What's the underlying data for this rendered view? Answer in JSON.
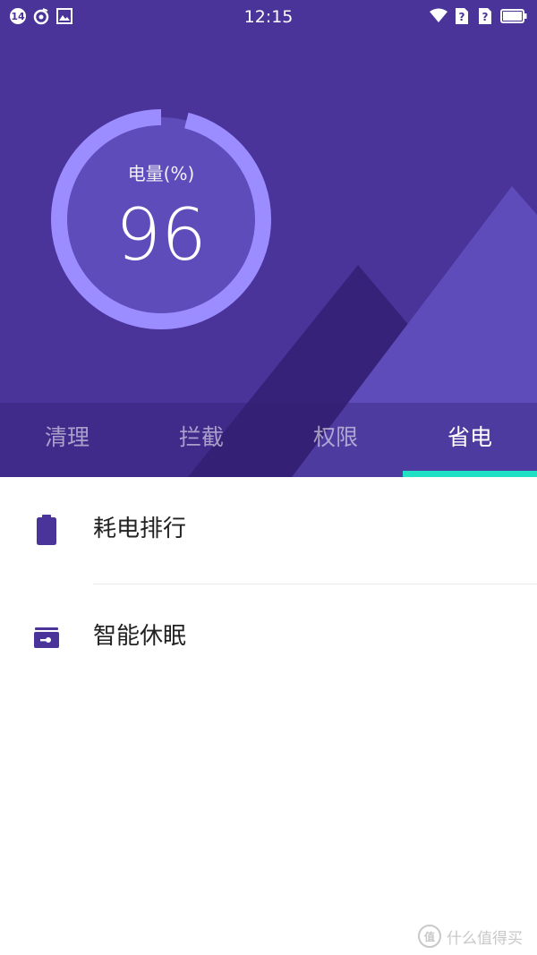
{
  "status_bar": {
    "notif_badge": "14",
    "time": "12:15"
  },
  "battery": {
    "label": "电量(%)",
    "value": "96",
    "level_percent": 96
  },
  "tabs": [
    {
      "label": "清理"
    },
    {
      "label": "拦截"
    },
    {
      "label": "权限"
    },
    {
      "label": "省电"
    }
  ],
  "active_tab_index": 3,
  "list": [
    {
      "label": "耗电排行",
      "icon": "battery-icon"
    },
    {
      "label": "智能休眠",
      "icon": "sleep-box-icon"
    }
  ],
  "watermark": {
    "text": "什么值得买",
    "badge": "值"
  },
  "colors": {
    "hero_bg": "#4a349a",
    "accent": "#20e0c4",
    "gauge_ring": "#9b8cff",
    "icon": "#4a349a"
  }
}
